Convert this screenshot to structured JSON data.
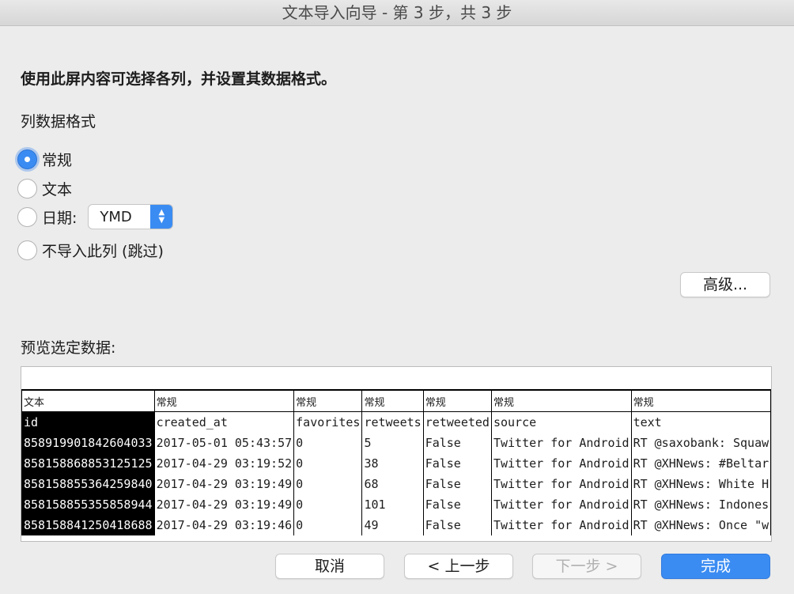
{
  "window_title": "文本导入向导 - 第 3 步，共 3 步",
  "instruction": "使用此屏内容可选择各列，并设置其数据格式。",
  "column_format_label": "列数据格式",
  "formats": {
    "general": "常规",
    "text": "文本",
    "date": "日期:",
    "skip": "不导入此列 (跳过)",
    "selected": "general"
  },
  "date_format": "YMD",
  "advanced_button": "高级...",
  "preview_label": "预览选定数据:",
  "preview": {
    "column_formats": [
      "文本",
      "常规",
      "常规",
      "常规",
      "常规",
      "常规",
      "常规"
    ],
    "headers": [
      "id",
      "created_at",
      "favorites",
      "retweets",
      "retweeted",
      "source",
      "text"
    ],
    "rows": [
      [
        "858919901842604033",
        "2017-05-01 05:43:57",
        "0",
        "5",
        "False",
        "Twitter for Android",
        "RT @saxobank: Squaw"
      ],
      [
        "858158868853125125",
        "2017-04-29 03:19:52",
        "0",
        "38",
        "False",
        "Twitter for Android",
        "RT @XHNews: #Beltar"
      ],
      [
        "858158855364259840",
        "2017-04-29 03:19:49",
        "0",
        "68",
        "False",
        "Twitter for Android",
        "RT @XHNews: White H"
      ],
      [
        "858158855355858944",
        "2017-04-29 03:19:49",
        "0",
        "101",
        "False",
        "Twitter for Android",
        "RT @XHNews: Indones"
      ],
      [
        "858158841250418688",
        "2017-04-29 03:19:46",
        "0",
        "49",
        "False",
        "Twitter for Android",
        "RT @XHNews: Once \"w"
      ]
    ]
  },
  "buttons": {
    "cancel": "取消",
    "back": "< 上一步",
    "next": "下一步 >",
    "finish": "完成"
  },
  "colors": {
    "accent": "#3b8cf2",
    "selected_column": "#000000"
  }
}
